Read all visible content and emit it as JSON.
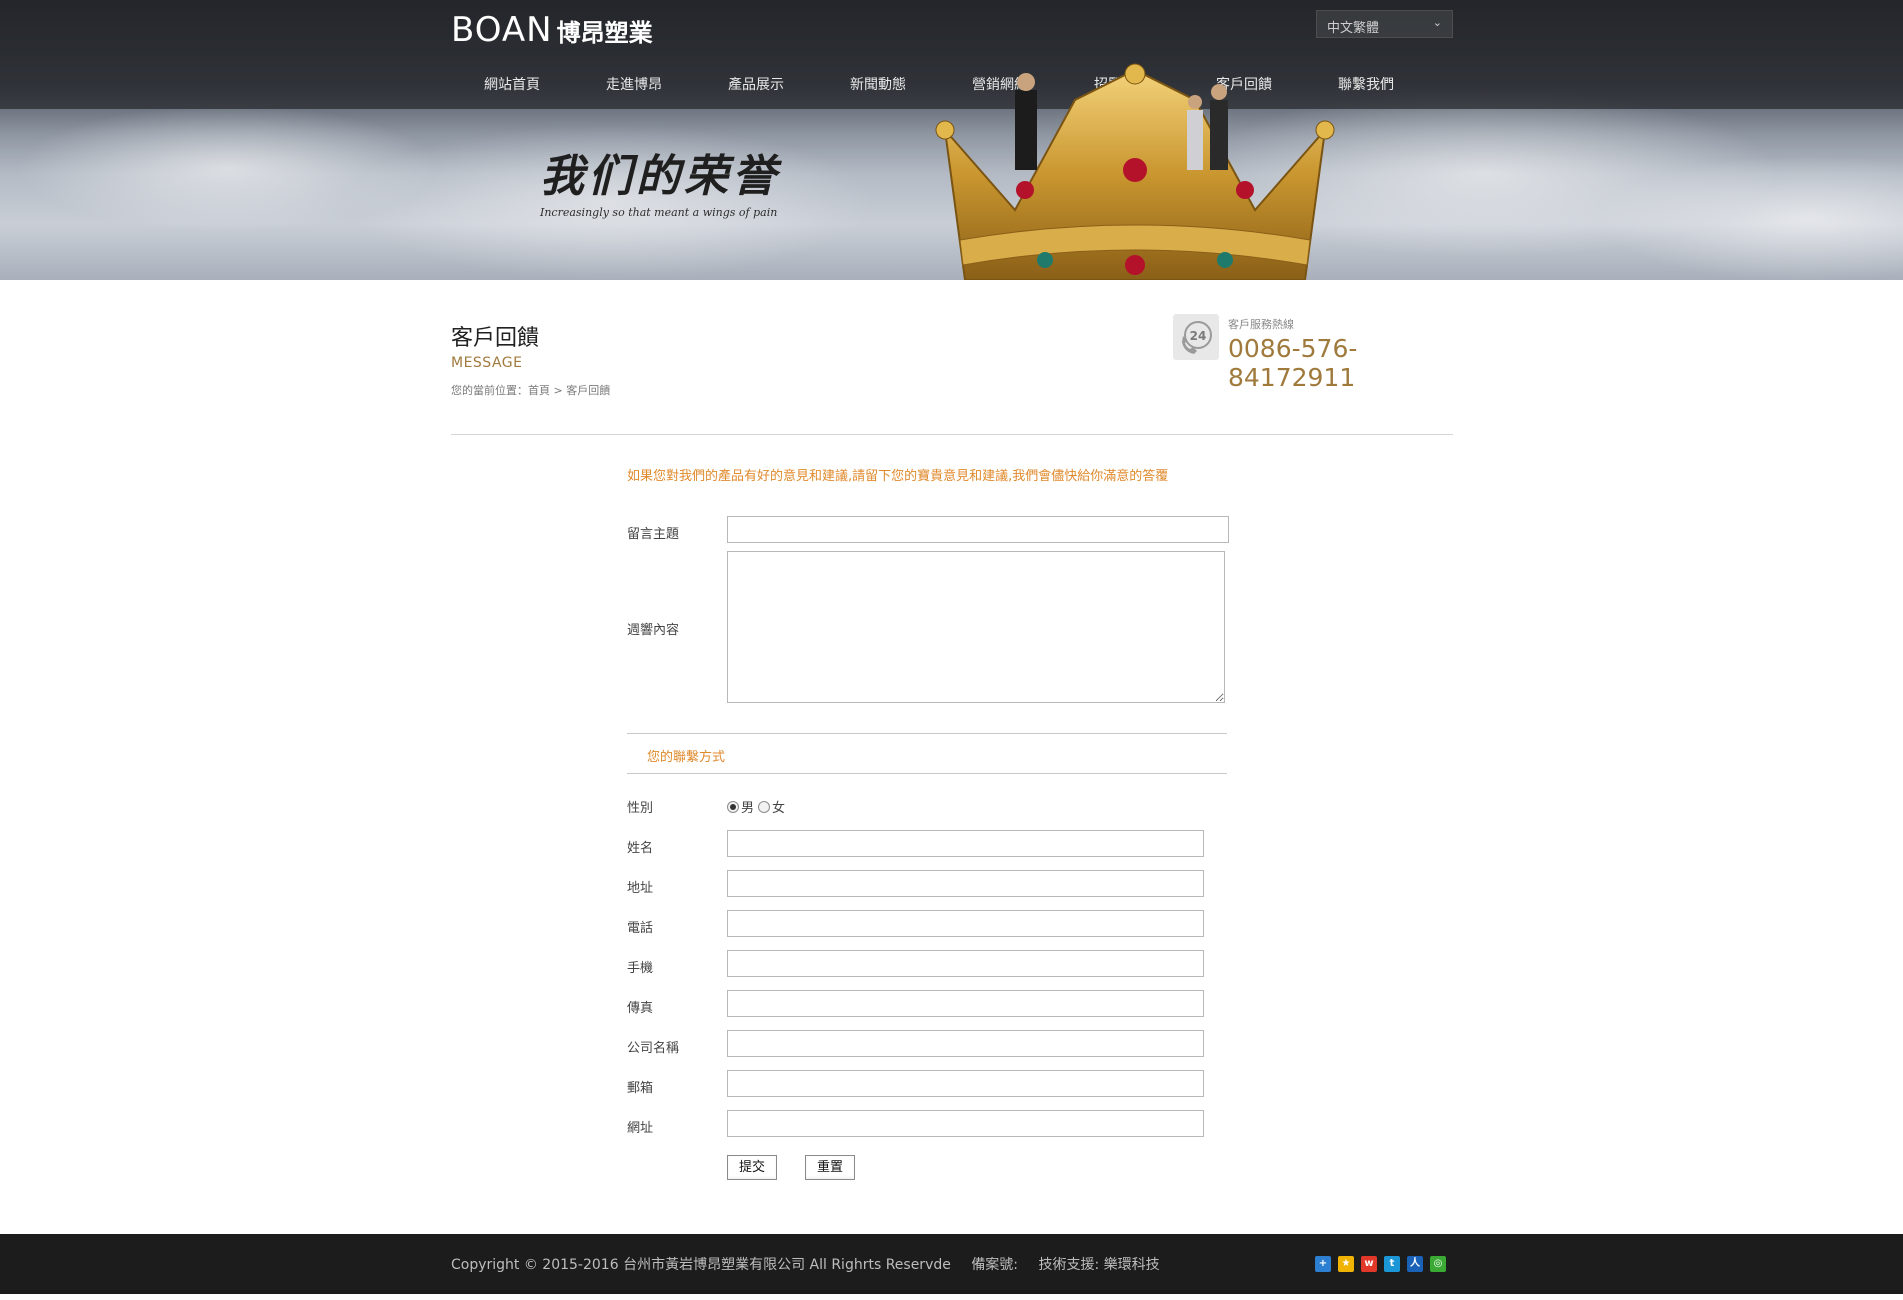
{
  "header": {
    "logo_en": "BOAN",
    "logo_cn": "博昂塑業",
    "language": "中文繁體",
    "nav": [
      {
        "label": "網站首頁"
      },
      {
        "label": "走進博昂"
      },
      {
        "label": "產品展示"
      },
      {
        "label": "新聞動態"
      },
      {
        "label": "營銷網絡"
      },
      {
        "label": "招賢納士"
      },
      {
        "label": "客戶回饋"
      },
      {
        "label": "聯繫我們"
      }
    ]
  },
  "banner": {
    "title": "我们的荣誉",
    "subtitle": "Increasingly  so that meant a wings of pain"
  },
  "page": {
    "title": "客戶回饋",
    "subtitle": "MESSAGE",
    "breadcrumb_prefix": "您的當前位置：",
    "breadcrumb_home": "首頁",
    "breadcrumb_sep": ">",
    "breadcrumb_current": "客戶回饋",
    "hotline_label": "客戶服務熱線",
    "hotline_number": "0086-576-84172911"
  },
  "form": {
    "intro": "如果您對我們的產品有好的意見和建議,請留下您的寶貴意見和建議,我們會儘快給你滿意的答覆",
    "subject_label": "留言主題",
    "content_label": "週響內容",
    "contact_section": "您的聯繫方式",
    "gender_label": "性別",
    "gender_options": [
      "男",
      "女"
    ],
    "gender_selected": "男",
    "name_label": "姓名",
    "address_label": "地址",
    "phone_label": "電話",
    "mobile_label": "手機",
    "fax_label": "傳真",
    "company_label": "公司名稱",
    "email_label": "郵箱",
    "website_label": "網址",
    "submit_label": "提交",
    "reset_label": "重置"
  },
  "footer": {
    "copyright": "Copyright © 2015-2016 台州市黃岩博昂塑業有限公司 All Righrts Reservde",
    "icp": "備案號:",
    "support": "技術支援: 樂環科技",
    "share_icons": [
      "share-more-icon",
      "qzone-icon",
      "weibo-icon",
      "tencent-weibo-icon",
      "renren-icon",
      "wechat-icon"
    ]
  },
  "colors": {
    "accent_orange": "#e08a2c",
    "accent_gold": "#a07a3c",
    "footer_bg": "#1c1c1c"
  }
}
